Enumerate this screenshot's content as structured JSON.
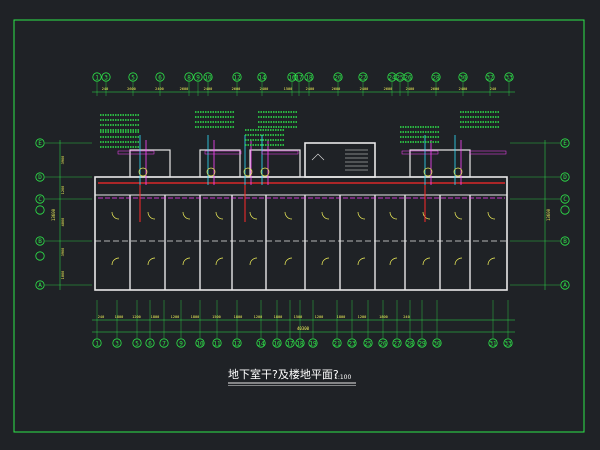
{
  "title": "地下室干?及楼地平面?",
  "scale": "1:100",
  "top_axes": [
    "1",
    "3",
    "5",
    "6",
    "8",
    "9",
    "10",
    "12",
    "14",
    "16",
    "17",
    "18",
    "20",
    "22",
    "24",
    "25",
    "26",
    "28",
    "30",
    "32",
    "33"
  ],
  "bottom_axes": [
    "1",
    "3",
    "5",
    "6",
    "7",
    "9",
    "10",
    "11",
    "12",
    "14",
    "16",
    "17",
    "18",
    "19",
    "21",
    "23",
    "25",
    "26",
    "27",
    "28",
    "29",
    "30",
    "31",
    "33"
  ],
  "left_axes": [
    "E",
    "D",
    "C",
    "B",
    "A"
  ],
  "right_axes": [
    "E",
    "D",
    "C",
    "B",
    "A"
  ],
  "top_dims": [
    "240",
    "2600",
    "2400",
    "2600",
    "2400",
    "2600",
    "2400",
    "1500",
    "2400",
    "2600",
    "2400",
    "2600",
    "2400",
    "2600",
    "2400",
    "240"
  ],
  "bottom_dims": [
    "240",
    "1800",
    "1200",
    "1800",
    "1200",
    "1800",
    "1500",
    "1800",
    "1200",
    "1800",
    "1500",
    "1200",
    "1800",
    "1200",
    "1800",
    "240"
  ],
  "total_dim": "40300",
  "left_dims": [
    "1800",
    "3900",
    "4800",
    "1200",
    "3900"
  ],
  "side_total": "13600",
  "colors": {
    "background": "#1f2226",
    "frame": "#2ee64a",
    "walls": "#e8e8e8",
    "pipe_red": "#ff2a2a",
    "pipe_cyan": "#33e0ff",
    "pipe_magenta": "#ff44ff",
    "annotation": "#f3f35a"
  }
}
